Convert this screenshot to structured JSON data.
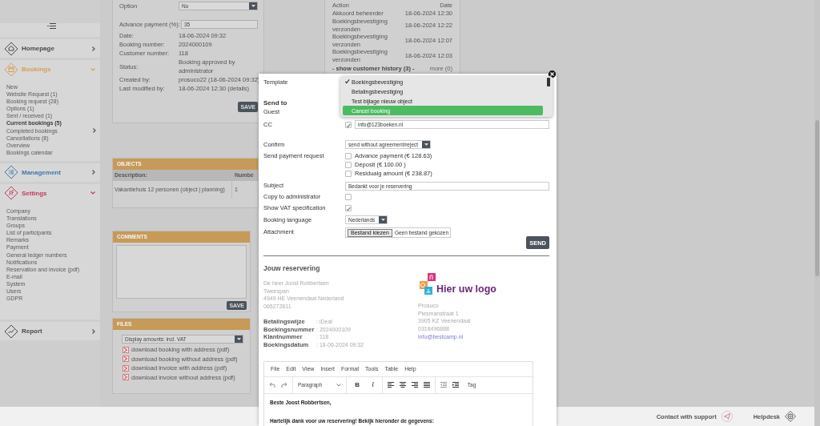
{
  "sidebar": {
    "items": [
      {
        "label": "Homepage",
        "kind": "home",
        "color": "#4a4a4a",
        "expanded": false
      },
      {
        "label": "Bookings",
        "kind": "bookings",
        "color": "#d99e58",
        "expanded": true,
        "children": [
          {
            "label": "New",
            "selected": false,
            "submenu": false
          },
          {
            "label": "Website Request (1)",
            "selected": false,
            "submenu": false
          },
          {
            "label": "Booking request (28)",
            "selected": false,
            "submenu": false
          },
          {
            "label": "Options (1)",
            "selected": false,
            "submenu": false
          },
          {
            "label": "Sent / received (1)",
            "selected": false,
            "submenu": false
          },
          {
            "label": "Current bookings (5)",
            "selected": true,
            "submenu": false
          },
          {
            "label": "Completed bookings",
            "selected": false,
            "submenu": true
          },
          {
            "label": "Cancellations (8)",
            "selected": false,
            "submenu": false
          },
          {
            "label": "Overview",
            "selected": false,
            "submenu": false
          },
          {
            "label": "Bookings calendar",
            "selected": false,
            "submenu": false
          }
        ]
      },
      {
        "label": "Management",
        "kind": "management",
        "color": "#3f78ad",
        "expanded": false
      },
      {
        "label": "Settings",
        "kind": "settings",
        "color": "#c23c5c",
        "expanded": true,
        "children": [
          {
            "label": "Company",
            "selected": false,
            "submenu": false
          },
          {
            "label": "Translations",
            "selected": false,
            "submenu": false
          },
          {
            "label": "Groups",
            "selected": false,
            "submenu": false
          },
          {
            "label": "List of participants",
            "selected": false,
            "submenu": false
          },
          {
            "label": "Remarks",
            "selected": false,
            "submenu": false
          },
          {
            "label": "Payment",
            "selected": false,
            "submenu": false
          },
          {
            "label": "General ledger numbers",
            "selected": false,
            "submenu": false
          },
          {
            "label": "Notifications",
            "selected": false,
            "submenu": false
          },
          {
            "label": "Reservation and invoice (pdf)",
            "selected": false,
            "submenu": false
          },
          {
            "label": "E-mail",
            "selected": false,
            "submenu": false
          },
          {
            "label": "System",
            "selected": false,
            "submenu": false
          },
          {
            "label": "Users",
            "selected": false,
            "submenu": false
          },
          {
            "label": "GDPR",
            "selected": false,
            "submenu": false
          }
        ]
      },
      {
        "label": "Report",
        "kind": "report",
        "color": "#4a4a4a",
        "expanded": false
      }
    ]
  },
  "booking": {
    "option": {
      "label": "Option",
      "value": "No"
    },
    "advance": {
      "label": "Advance payment (%):",
      "value": "35"
    },
    "rows": [
      {
        "label": "Date:",
        "value": "18-06-2024 09:32"
      },
      {
        "label": "Booking number:",
        "value": "2024000109"
      },
      {
        "label": "Customer number:",
        "value": "118"
      },
      {
        "label": "Status:",
        "value": "Booking approved by administrator"
      },
      {
        "label": "Created by:",
        "value": "prosuco22 (18-06-2024 09:32)"
      },
      {
        "label": "Last modified by:",
        "value": "18-06-2024 12:30 (details)"
      }
    ],
    "save": "SAVE"
  },
  "history": {
    "columns": [
      "Action",
      "Date"
    ],
    "rows": [
      {
        "action": "Akkoord beheerder",
        "date": "18-06-2024 12:30"
      },
      {
        "action": "Boekingsbevestiging verzonden",
        "date": "18-06-2024 12:22"
      },
      {
        "action": "Boekingsbevestiging verzonden",
        "date": "18-06-2024 12:07"
      },
      {
        "action": "Boekingsbevestiging verzonden",
        "date": "18-06-2024 12:03"
      }
    ],
    "show_history": "- show customer history (3) -",
    "more": "more (0)"
  },
  "objects": {
    "title": "OBJECTS",
    "columns": [
      "Description:",
      "Numbe"
    ],
    "rows": [
      [
        "Vakantiehuis 12 personen (object | planning)",
        "1"
      ]
    ]
  },
  "comments": {
    "title": "COMMENTS",
    "save": "SAVE"
  },
  "files": {
    "title": "FILES",
    "select": "Display amounts: incl. VAT",
    "links": [
      "download booking with address (pdf)",
      "download booking without address (pdf)",
      "download invoice with address (pdf)",
      "download invoice without address (pdf)"
    ]
  },
  "modal": {
    "template": {
      "label": "Template",
      "options": [
        {
          "label": "Boekingsbevestiging",
          "selected": true,
          "highlighted": false
        },
        {
          "label": "Betalingsbevestiging",
          "selected": false,
          "highlighted": false
        },
        {
          "label": "Test bijlage nieuw object",
          "selected": false,
          "highlighted": false
        },
        {
          "label": "Cancel booking",
          "selected": false,
          "highlighted": true
        }
      ]
    },
    "send_to": "Send to",
    "guest": {
      "label": "Guest"
    },
    "cc": {
      "label": "CC",
      "checked": true,
      "value": "info@123boeken.nl"
    },
    "confirm": {
      "label": "Confirm",
      "value": "send without agreement/reject"
    },
    "payment": {
      "label": "Send payment request",
      "options": [
        {
          "label": "Advance payment (€ 128.63)",
          "checked": false
        },
        {
          "label": "Deposit (€ 100.00 )",
          "checked": false
        },
        {
          "label": "Residualg amount (€ 238.87)",
          "checked": false
        }
      ]
    },
    "subject": {
      "label": "Subject",
      "value": "Bedankt voor je reservering"
    },
    "copy_admin": {
      "label": "Copy to administrator",
      "checked": false
    },
    "show_vat": {
      "label": "Show VAT specification",
      "checked": true
    },
    "language": {
      "label": "Booking language",
      "value": "Nederlands"
    },
    "attachment": {
      "label": "Attachment",
      "button": "Bestand kiezen",
      "status": "Geen bestand gekozen"
    },
    "send": "SEND"
  },
  "preview": {
    "title": "Jouw reservering",
    "guest_lines": [
      "De heer Joost Robbertsen",
      "Tweespan",
      "4949 HE Veenendaal Nederland",
      "065272811"
    ],
    "details": [
      {
        "label": "Betalingswijze",
        "value": ": iDeal"
      },
      {
        "label": "Boekingsnummer",
        "value": ": 2024000109"
      },
      {
        "label": "Klantnummer",
        "value": ": 118"
      },
      {
        "label": "Boekingsdatum",
        "value": ": 18-06-2024 09:32"
      }
    ],
    "logo": "Hier uw logo",
    "company_lines": [
      "Prosuco",
      "Plesmanstraat 1",
      "3905 KZ Veenendaal",
      "0318496888"
    ],
    "email": "info@bestcamp.nl"
  },
  "editor": {
    "menu": [
      "File",
      "Edit",
      "View",
      "Insert",
      "Format",
      "Tools",
      "Table",
      "Help"
    ],
    "block_format": "Paragraph",
    "bold": "B",
    "italic": "I",
    "tag": "Tag",
    "paragraphs": [
      "Beste Joost Robbertsen,",
      "Hartelijk dank voor uw reservering! Bekijk hieronder de gegevens:"
    ]
  },
  "footer": {
    "support": "Contact with support",
    "helpdesk": "Helpdesk"
  }
}
